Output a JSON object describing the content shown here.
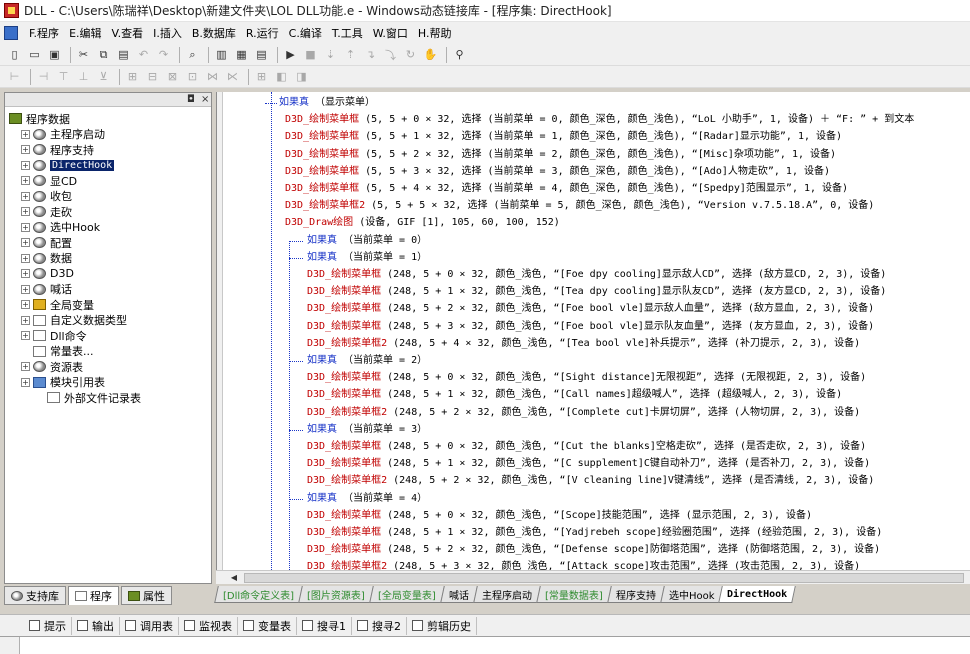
{
  "window": {
    "title": "DLL - C:\\Users\\陈瑞祥\\Desktop\\新建文件夹\\LOL DLL功能.e - Windows动态链接库 - [程序集: DirectHook]"
  },
  "menu": [
    "F.程序",
    "E.编辑",
    "V.查看",
    "I.插入",
    "B.数据库",
    "R.运行",
    "C.编译",
    "T.工具",
    "W.窗口",
    "H.帮助"
  ],
  "left_panel": {
    "controls": [
      "◘",
      "×"
    ],
    "tree": [
      {
        "label": "程序数据",
        "expander": "",
        "icon": "book",
        "level": 0
      },
      {
        "label": "主程序启动",
        "expander": "+",
        "icon": "disc",
        "level": 1
      },
      {
        "label": "程序支持",
        "expander": "+",
        "icon": "disc",
        "level": 1
      },
      {
        "label": "DirectHook",
        "expander": "+",
        "icon": "disc",
        "level": 1,
        "selected": true
      },
      {
        "label": "显CD",
        "expander": "+",
        "icon": "disc",
        "level": 1
      },
      {
        "label": "收包",
        "expander": "+",
        "icon": "disc",
        "level": 1
      },
      {
        "label": "走砍",
        "expander": "+",
        "icon": "disc",
        "level": 1
      },
      {
        "label": "选中Hook",
        "expander": "+",
        "icon": "disc",
        "level": 1
      },
      {
        "label": "配置",
        "expander": "+",
        "icon": "disc",
        "level": 1
      },
      {
        "label": "数据",
        "expander": "+",
        "icon": "disc",
        "level": 1
      },
      {
        "label": "D3D",
        "expander": "+",
        "icon": "disc",
        "level": 1
      },
      {
        "label": "喊话",
        "expander": "+",
        "icon": "disc",
        "level": 1
      },
      {
        "label": "全局变量",
        "expander": "+",
        "icon": "lock",
        "level": 1
      },
      {
        "label": "自定义数据类型",
        "expander": "+",
        "icon": "doc",
        "level": 1
      },
      {
        "label": "Dll命令",
        "expander": "+",
        "icon": "doc",
        "level": 1
      },
      {
        "label": "常量表...",
        "expander": "",
        "icon": "doc",
        "level": 1
      },
      {
        "label": "资源表",
        "expander": "+",
        "icon": "disc",
        "level": 1
      },
      {
        "label": "模块引用表",
        "expander": "+",
        "icon": "db",
        "level": 1
      },
      {
        "label": "外部文件记录表",
        "expander": "",
        "icon": "doc",
        "level": 2
      }
    ]
  },
  "left_tabs": [
    {
      "label": "支持库",
      "active": false
    },
    {
      "label": "程序",
      "active": true
    },
    {
      "label": "属性",
      "active": false
    }
  ],
  "code_lines": [
    {
      "x": 62,
      "parts": [
        [
          "kw",
          "如果真"
        ],
        [
          "",
          " （显示菜单）"
        ]
      ]
    },
    {
      "x": 68,
      "parts": [
        [
          "fn",
          "D3D_绘制菜单框"
        ],
        [
          "",
          " (5, 5 + 0 × 32, 选择 (当前菜单 = 0, 颜色_深色, 颜色_浅色), “LoL 小助手”, 1, 设备) ＋ “F: ” + 到文本"
        ]
      ]
    },
    {
      "x": 68,
      "parts": [
        [
          "fn",
          "D3D_绘制菜单框"
        ],
        [
          "",
          " (5, 5 + 1 × 32, 选择 (当前菜单 = 1, 颜色_深色, 颜色_浅色), “[Radar]显示功能”, 1, 设备)"
        ]
      ]
    },
    {
      "x": 68,
      "parts": [
        [
          "fn",
          "D3D_绘制菜单框"
        ],
        [
          "",
          " (5, 5 + 2 × 32, 选择 (当前菜单 = 2, 颜色_深色, 颜色_浅色), “[Misc]杂项功能”, 1, 设备)"
        ]
      ]
    },
    {
      "x": 68,
      "parts": [
        [
          "fn",
          "D3D_绘制菜单框"
        ],
        [
          "",
          " (5, 5 + 3 × 32, 选择 (当前菜单 = 3, 颜色_深色, 颜色_浅色), “[Ado]人物走砍”, 1, 设备)"
        ]
      ]
    },
    {
      "x": 68,
      "parts": [
        [
          "fn",
          "D3D_绘制菜单框"
        ],
        [
          "",
          " (5, 5 + 4 × 32, 选择 (当前菜单 = 4, 颜色_深色, 颜色_浅色), “[Spedpy]范围显示”, 1, 设备)"
        ]
      ]
    },
    {
      "x": 68,
      "parts": [
        [
          "fn",
          "D3D_绘制菜单框2"
        ],
        [
          "",
          " (5, 5 + 5 × 32, 选择 (当前菜单 = 5, 颜色_深色, 颜色_浅色), “Version v.7.5.18.A”, 0, 设备)"
        ]
      ]
    },
    {
      "x": 68,
      "parts": [
        [
          "fn",
          "D3D_Draw绘图"
        ],
        [
          "",
          " (设备, GIF [1], 105, 60, 100, 152)"
        ]
      ]
    },
    {
      "x": 90,
      "parts": [
        [
          "kw",
          "如果真"
        ],
        [
          "",
          " （当前菜单 = 0）"
        ]
      ]
    },
    {
      "x": 90,
      "parts": [
        [
          "kw",
          "如果真"
        ],
        [
          "",
          " （当前菜单 = 1）"
        ]
      ]
    },
    {
      "x": 90,
      "parts": [
        [
          "fn",
          "D3D_绘制菜单框"
        ],
        [
          "",
          " (248, 5 + 0 × 32, 颜色_浅色, “[Foe dpy cooling]显示敌人CD”, 选择 (敌方显CD, 2, 3), 设备)"
        ]
      ]
    },
    {
      "x": 90,
      "parts": [
        [
          "fn",
          "D3D_绘制菜单框"
        ],
        [
          "",
          " (248, 5 + 1 × 32, 颜色_浅色, “[Tea dpy cooling]显示队友CD”, 选择 (友方显CD, 2, 3), 设备)"
        ]
      ]
    },
    {
      "x": 90,
      "parts": [
        [
          "fn",
          "D3D_绘制菜单框"
        ],
        [
          "",
          " (248, 5 + 2 × 32, 颜色_浅色, “[Foe bool vle]显示敌人血量”, 选择 (敌方显血, 2, 3), 设备)"
        ]
      ]
    },
    {
      "x": 90,
      "parts": [
        [
          "fn",
          "D3D_绘制菜单框"
        ],
        [
          "",
          " (248, 5 + 3 × 32, 颜色_浅色, “[Foe bool vle]显示队友血量”, 选择 (友方显血, 2, 3), 设备)"
        ]
      ]
    },
    {
      "x": 90,
      "parts": [
        [
          "fn",
          "D3D_绘制菜单框2"
        ],
        [
          "",
          " (248, 5 + 4 × 32, 颜色_浅色, “[Tea bool vle]补兵提示”, 选择 (补刀提示, 2, 3), 设备)"
        ]
      ]
    },
    {
      "x": 90,
      "parts": [
        [
          "kw",
          "如果真"
        ],
        [
          "",
          " （当前菜单 = 2）"
        ]
      ]
    },
    {
      "x": 90,
      "parts": [
        [
          "fn",
          "D3D_绘制菜单框"
        ],
        [
          "",
          " (248, 5 + 0 × 32, 颜色_浅色, “[Sight distance]无限视距”, 选择 (无限视距, 2, 3), 设备)"
        ]
      ]
    },
    {
      "x": 90,
      "parts": [
        [
          "fn",
          "D3D_绘制菜单框"
        ],
        [
          "",
          " (248, 5 + 1 × 32, 颜色_浅色, “[Call names]超级喊人”, 选择 (超级喊人, 2, 3), 设备)"
        ]
      ]
    },
    {
      "x": 90,
      "parts": [
        [
          "fn",
          "D3D_绘制菜单框2"
        ],
        [
          "",
          " (248, 5 + 2 × 32, 颜色_浅色, “[Complete cut]卡屏切屏”, 选择 (人物切屏, 2, 3), 设备)"
        ]
      ]
    },
    {
      "x": 90,
      "parts": [
        [
          "kw",
          "如果真"
        ],
        [
          "",
          " （当前菜单 = 3）"
        ]
      ]
    },
    {
      "x": 90,
      "parts": [
        [
          "fn",
          "D3D_绘制菜单框"
        ],
        [
          "",
          " (248, 5 + 0 × 32, 颜色_浅色, “[Cut the blanks]空格走砍”, 选择 (是否走砍, 2, 3), 设备)"
        ]
      ]
    },
    {
      "x": 90,
      "parts": [
        [
          "fn",
          "D3D_绘制菜单框"
        ],
        [
          "",
          " (248, 5 + 1 × 32, 颜色_浅色, “[C supplement]C键自动补刀”, 选择 (是否补刀, 2, 3), 设备)"
        ]
      ]
    },
    {
      "x": 90,
      "parts": [
        [
          "fn",
          "D3D_绘制菜单框2"
        ],
        [
          "",
          " (248, 5 + 2 × 32, 颜色_浅色, “[V cleaning line]V键清线”, 选择 (是否清线, 2, 3), 设备)"
        ]
      ]
    },
    {
      "x": 90,
      "parts": [
        [
          "kw",
          "如果真"
        ],
        [
          "",
          " （当前菜单 = 4）"
        ]
      ]
    },
    {
      "x": 90,
      "parts": [
        [
          "fn",
          "D3D_绘制菜单框"
        ],
        [
          "",
          " (248, 5 + 0 × 32, 颜色_浅色, “[Scope]技能范围”, 选择 (显示范围, 2, 3), 设备)"
        ]
      ]
    },
    {
      "x": 90,
      "parts": [
        [
          "fn",
          "D3D_绘制菜单框"
        ],
        [
          "",
          " (248, 5 + 1 × 32, 颜色_浅色, “[Yadjrebeh scope]经验圈范围”, 选择 (经验范围, 2, 3), 设备)"
        ]
      ]
    },
    {
      "x": 90,
      "parts": [
        [
          "fn",
          "D3D_绘制菜单框"
        ],
        [
          "",
          " (248, 5 + 2 × 32, 颜色_浅色, “[Defense scope]防御塔范围”, 选择 (防御塔范围, 2, 3), 设备)"
        ]
      ]
    },
    {
      "x": 90,
      "parts": [
        [
          "fn",
          "D3D_绘制菜单框2"
        ],
        [
          "",
          " (248, 5 + 3 × 32, 颜色_浅色, “[Attack scope]攻击范围”, 选择 (攻击范围, 2, 3), 设备)"
        ]
      ]
    }
  ],
  "editor_tabs": [
    {
      "label": "[Dll命令定义表]",
      "style": "green"
    },
    {
      "label": "[图片资源表]",
      "style": "green"
    },
    {
      "label": "[全局变量表]",
      "style": "green"
    },
    {
      "label": "喊话",
      "style": ""
    },
    {
      "label": "主程序启动",
      "style": ""
    },
    {
      "label": "[常量数据表]",
      "style": "green"
    },
    {
      "label": "程序支持",
      "style": ""
    },
    {
      "label": "选中Hook",
      "style": ""
    },
    {
      "label": "DirectHook",
      "style": "active"
    }
  ],
  "bottom_tabs": [
    "提示",
    "输出",
    "调用表",
    "监视表",
    "变量表",
    "搜寻1",
    "搜寻2",
    "剪辑历史"
  ],
  "colors": {
    "keyword": "#1a35c8",
    "function": "#c00000",
    "selection": "#0a246a",
    "tab_green": "#2e8b2e"
  }
}
